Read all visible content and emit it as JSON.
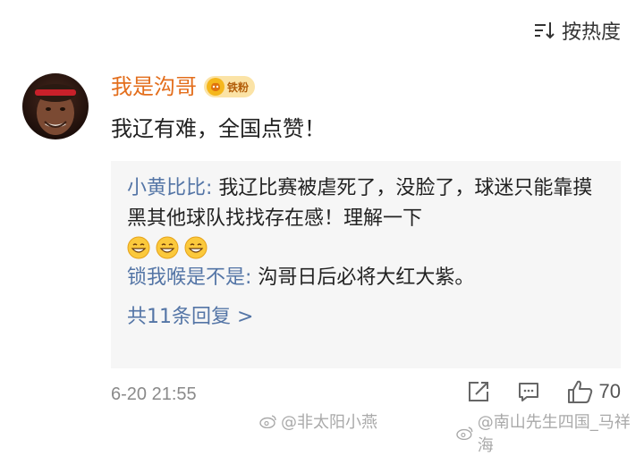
{
  "sort": {
    "label": "按热度",
    "icon": "sort-icon"
  },
  "comment": {
    "username": "我是沟哥",
    "badge": "铁粉",
    "text": "我辽有难，全国点赞！",
    "time": "6-20 21:55",
    "like_count": "70"
  },
  "replies": [
    {
      "user": "小黄比比:",
      "text": " 我辽比赛被虐死了，没脸了，球迷只能靠摸黑其他球队找找存在感！理解一下",
      "emoji_count": 3
    },
    {
      "user": "锁我喉是不是:",
      "text": " 沟哥日后必将大红大紫。"
    }
  ],
  "more_replies": "共11条回复 >",
  "watermarks": [
    "@非太阳小燕",
    "@南山先生四国_马祥海"
  ],
  "colors": {
    "username": "#e36e1c",
    "reply_user": "#5475a6",
    "panel_bg": "#f6f6f6",
    "badge_bg": "#fbe3a6"
  }
}
